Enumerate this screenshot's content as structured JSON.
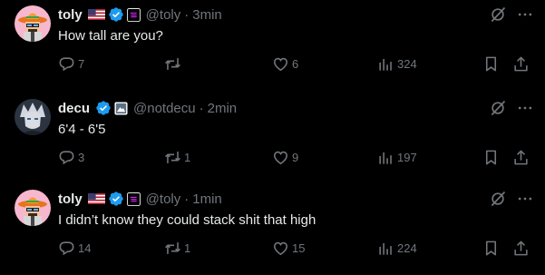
{
  "tweets": [
    {
      "name": "toly",
      "handle": "@toly",
      "time": "3min",
      "text": "How tall are you?",
      "replies": "7",
      "retweets": "",
      "likes": "6",
      "views": "324",
      "avatar": "pixel-sombrero-avatar",
      "flag": "us-flag-icon",
      "affiliate": "solana-badge-icon"
    },
    {
      "name": "decu",
      "handle": "@notdecu",
      "time": "2min",
      "text": "6'4 - 6'5",
      "replies": "3",
      "retweets": "1",
      "likes": "9",
      "views": "197",
      "avatar": "anime-character-avatar",
      "affiliate": "mountain-badge-icon"
    },
    {
      "name": "toly",
      "handle": "@toly",
      "time": "1min",
      "text": "I didn’t know they could stack shit that high",
      "replies": "14",
      "retweets": "1",
      "likes": "15",
      "views": "224",
      "avatar": "pixel-sombrero-avatar",
      "flag": "us-flag-icon",
      "affiliate": "solana-badge-icon"
    }
  ],
  "separator": "·",
  "colors": {
    "background": "#000000",
    "primary_text": "#e7e9ea",
    "secondary_text": "#71767b",
    "verified": "#1d9bf0"
  }
}
